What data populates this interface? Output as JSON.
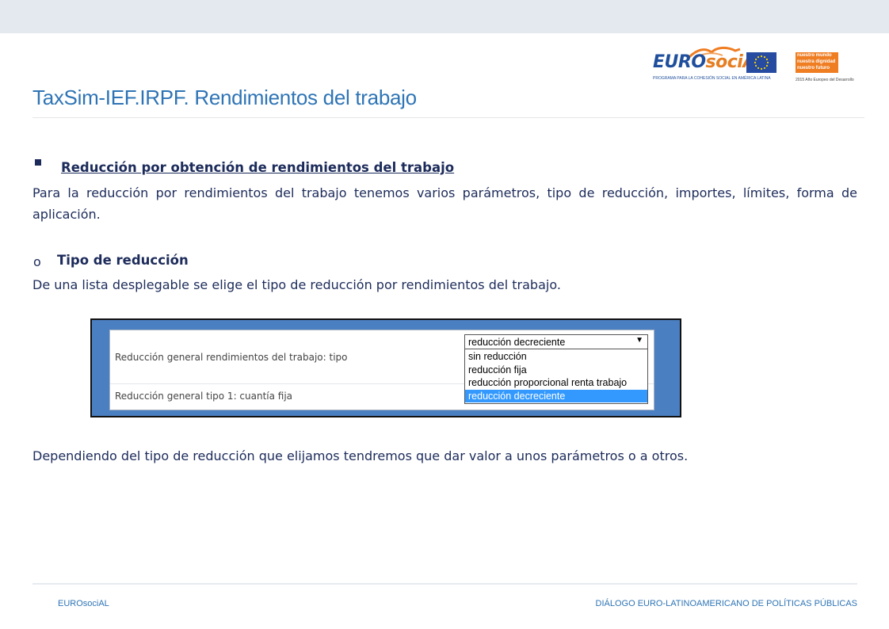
{
  "header": {
    "logo": {
      "name_euro": "EURO",
      "name_social": "sociAL",
      "tagline": "PROGRAMA PARA LA COHESIÓN SOCIAL EN AMÉRICA LATINA",
      "campaign_lines": [
        "nuestro mundo",
        "nuestra dignidad",
        "nuestro futuro"
      ],
      "campaign_year": "2015 Año Europeo del Desarrollo",
      "brand_blue": "#1f4e9c",
      "brand_orange": "#ef7d22"
    }
  },
  "title": "TaxSim-IEF.IRPF. Rendimientos del trabajo",
  "section": {
    "heading": "Reducción por obtención de rendimientos del trabajo",
    "paragraph": "Para la reducción por rendimientos del trabajo tenemos varios parámetros, tipo de reducción, importes, límites, forma de aplicación.",
    "sub_bullet": "o",
    "subheading": "Tipo de reducción",
    "sub_paragraph": "De una lista desplegable se elige el tipo de reducción por rendimientos del trabajo.",
    "closing": "Dependiendo del tipo de reducción que elijamos tendremos que dar valor a unos parámetros o a otros."
  },
  "screenshot": {
    "row1_label": "Reducción general rendimientos del trabajo: tipo",
    "row2_label": "Reducción general tipo 1: cuantía fija",
    "select_value": "reducción decreciente",
    "arrow": "▼",
    "options": [
      "sin reducción",
      "reducción fija",
      "reducción proporcional renta trabajo",
      "reducción decreciente"
    ],
    "selected_index": 3,
    "highlight_color": "#3399ff",
    "frame_color": "#4a7fc1"
  },
  "footer": {
    "left": "EUROsociAL",
    "right": "DIÁLOGO EURO-LATINOAMERICANO DE POLÍTICAS PÚBLICAS"
  }
}
